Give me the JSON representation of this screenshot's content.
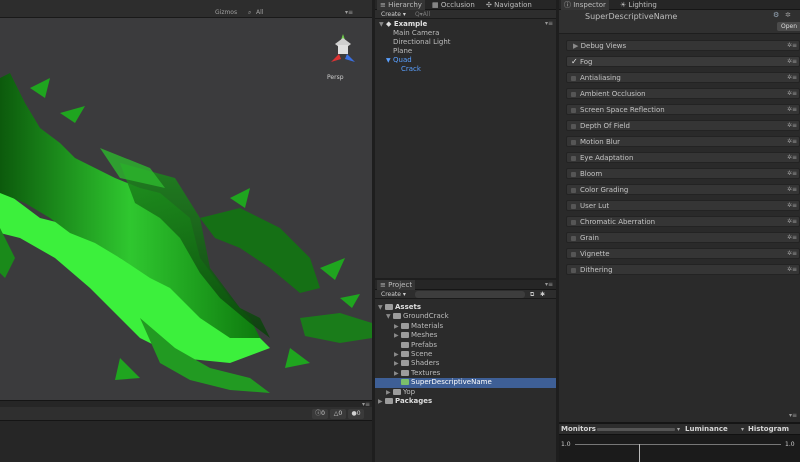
{
  "scene": {
    "gizmos": "Gizmos",
    "all": "All",
    "persp": "Persp",
    "counts": {
      "info": "0",
      "warn": "0",
      "error": "0"
    }
  },
  "hierarchy": {
    "tabs": [
      "Hierarchy",
      "Occlusion",
      "Navigation"
    ],
    "create": "Create",
    "search_placeholder": "Q▾All",
    "scene_name": "Example",
    "items": [
      "Main Camera",
      "Directional Light",
      "Plane",
      "Quad",
      "Crack"
    ]
  },
  "project": {
    "tab": "Project",
    "create": "Create",
    "rows": [
      "Assets",
      "GroundCrack",
      "Materials",
      "Meshes",
      "Prefabs",
      "Scene",
      "Shaders",
      "Textures",
      "SuperDescriptiveName",
      "Yop",
      "Packages"
    ]
  },
  "inspector": {
    "tabs": [
      "Inspector",
      "Lighting"
    ],
    "object_name": "SuperDescriptiveName",
    "open_label": "Open",
    "effects": [
      "Debug Views",
      "Fog",
      "Antialiasing",
      "Ambient Occlusion",
      "Screen Space Reflection",
      "Depth Of Field",
      "Motion Blur",
      "Eye Adaptation",
      "Bloom",
      "Color Grading",
      "User Lut",
      "Chromatic Aberration",
      "Grain",
      "Vignette",
      "Dithering"
    ]
  },
  "monitors": {
    "title": "Monitors",
    "tab_luminance": "Luminance",
    "tab_histogram": "Histogram",
    "scale_top": "1.0",
    "scale_bottom": "1.0"
  },
  "colors": {
    "selection": "#3e5f96",
    "accent_blue": "#5aa0ff",
    "crack_green": "#39ff3a"
  }
}
